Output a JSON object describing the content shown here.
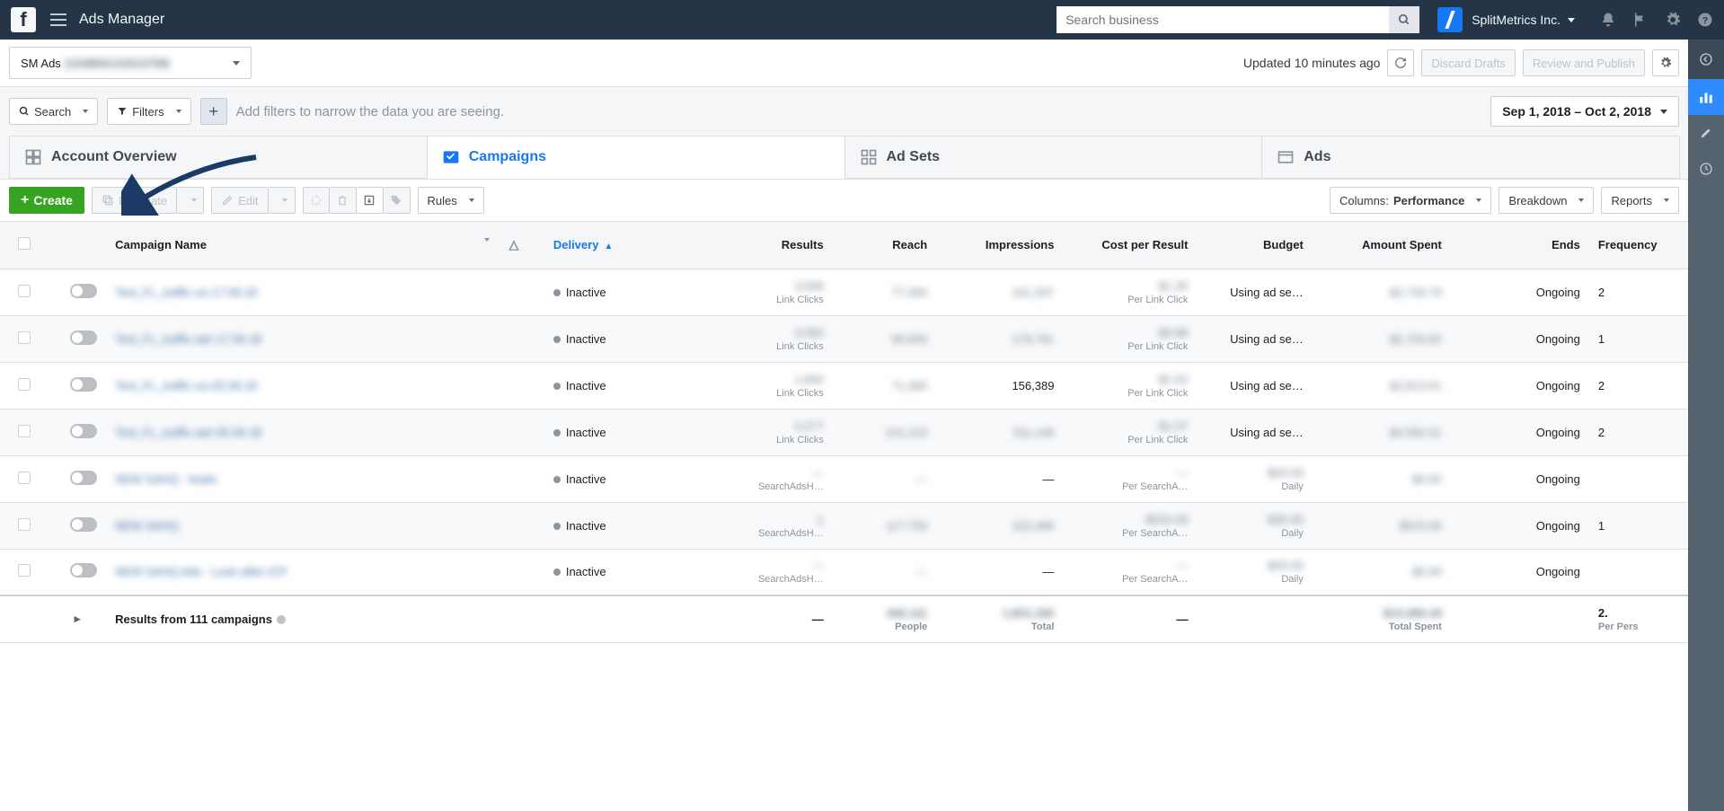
{
  "topbar": {
    "title": "Ads Manager",
    "search_placeholder": "Search business",
    "company": "SplitMetrics Inc."
  },
  "account_bar": {
    "account_name": "SM Ads",
    "account_id": "(104884131913758)",
    "updated_text": "Updated 10 minutes ago",
    "discard_label": "Discard Drafts",
    "review_label": "Review and Publish"
  },
  "filters_bar": {
    "search_label": "Search",
    "filters_label": "Filters",
    "hint": "Add filters to narrow the data you are seeing.",
    "date_range": "Sep 1, 2018 – Oct 2, 2018"
  },
  "tabs": {
    "overview": "Account Overview",
    "campaigns": "Campaigns",
    "adsets": "Ad Sets",
    "ads": "Ads"
  },
  "toolbar": {
    "create_label": "Create",
    "duplicate_label": "Duplicate",
    "edit_label": "Edit",
    "rules_label": "Rules",
    "columns_prefix": "Columns: ",
    "columns_value": "Performance",
    "breakdown_label": "Breakdown",
    "reports_label": "Reports"
  },
  "columns": {
    "name": "Campaign Name",
    "delivery": "Delivery",
    "results": "Results",
    "reach": "Reach",
    "impressions": "Impressions",
    "cost": "Cost per Result",
    "budget": "Budget",
    "spent": "Amount Spent",
    "ends": "Ends",
    "frequency": "Frequency"
  },
  "rows": [
    {
      "name": "Test_FL_traffic-us-17.09.18",
      "delivery": "Inactive",
      "results": "3,008",
      "results_sub": "Link Clicks",
      "reach": "77,284",
      "impressions": "161,337",
      "cost": "$1.35",
      "cost_sub": "Per Link Click",
      "budget": "Using ad se…",
      "spent": "$2,733.79",
      "ends": "Ongoing",
      "freq": "2"
    },
    {
      "name": "Test_FL_traffic-adr-17.09.18",
      "delivery": "Inactive",
      "results": "3,084",
      "results_sub": "Link Clicks",
      "reach": "96,656",
      "impressions": "179,791",
      "cost": "$0.88",
      "cost_sub": "Per Link Click",
      "budget": "Using ad se…",
      "spent": "$2,704.82",
      "ends": "Ongoing",
      "freq": "1"
    },
    {
      "name": "Test_FL_traffic-us-05.09.18",
      "delivery": "Inactive",
      "results": "1,840",
      "results_sub": "Link Clicks",
      "reach": "71,360",
      "impressions": "156,389",
      "cost": "$1.52",
      "cost_sub": "Per Link Click",
      "budget": "Using ad se…",
      "spent": "$2,813.01",
      "ends": "Ongoing",
      "freq": "2"
    },
    {
      "name": "Test_FL_traffic-adr-05.09.18",
      "delivery": "Inactive",
      "results": "4,277",
      "results_sub": "Link Clicks",
      "reach": "141,215",
      "impressions": "311,146",
      "cost": "$1.07",
      "cost_sub": "Per Link Click",
      "budget": "Using ad se…",
      "spent": "$4,582.01",
      "ends": "Ongoing",
      "freq": "2"
    },
    {
      "name": "NEW SAHQ - leads",
      "delivery": "Inactive",
      "results": "—",
      "results_sub": "SearchAdsH…",
      "reach": "—",
      "impressions": "—",
      "cost": "—",
      "cost_sub": "Per SearchA…",
      "budget": "$20.00",
      "budget_sub": "Daily",
      "spent": "$0.00",
      "ends": "Ongoing",
      "freq": ""
    },
    {
      "name": "NEW SAHQ",
      "delivery": "Inactive",
      "results": "1",
      "results_sub": "SearchAdsH…",
      "reach": "117,750",
      "impressions": "222,490",
      "cost": "$523.06",
      "cost_sub": "Per SearchA…",
      "budget": "$30.00",
      "budget_sub": "Daily",
      "spent": "$523.06",
      "ends": "Ongoing",
      "freq": "1"
    },
    {
      "name": "NEW SAHQ Ads - Look alike ICP",
      "delivery": "Inactive",
      "results": "—",
      "results_sub": "SearchAdsH…",
      "reach": "—",
      "impressions": "—",
      "cost": "—",
      "cost_sub": "Per SearchA…",
      "budget": "$20.00",
      "budget_sub": "Daily",
      "spent": "$0.00",
      "ends": "Ongoing",
      "freq": ""
    }
  ],
  "footer": {
    "label": "Results from 111 campaigns",
    "results": "—",
    "reach": "442,111",
    "reach_sub": "People",
    "impressions": "1,831,182",
    "impr_sub": "Total",
    "cost": "—",
    "spent": "$13,386.18",
    "spent_sub": "Total Spent",
    "freq": "2.",
    "freq_sub": "Per Pers"
  }
}
